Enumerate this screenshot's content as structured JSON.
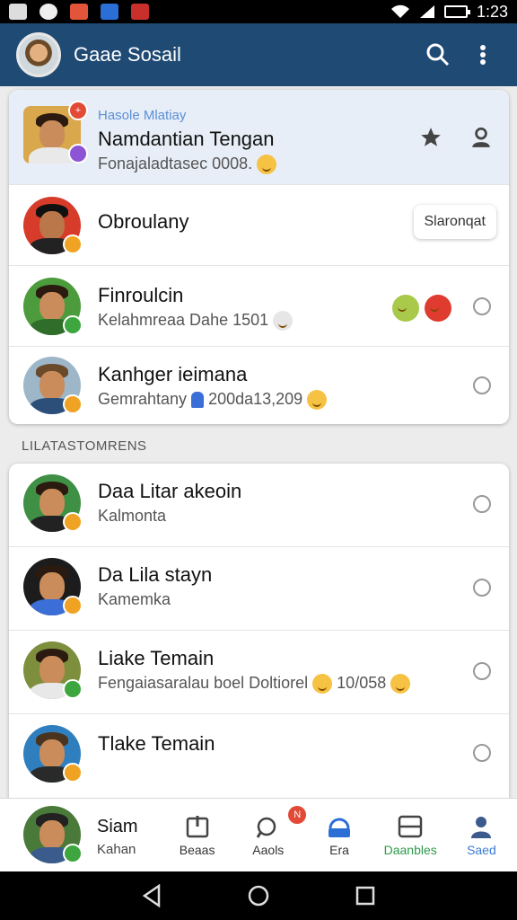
{
  "status_bar": {
    "time": "1:23"
  },
  "app_bar": {
    "title": "Gaae Sosail"
  },
  "top_card": {
    "label": "Hasole Mlatiay",
    "name": "Namdantian Tengan",
    "subtitle": "Fonajaladtasec 0008.",
    "badge_text": "+"
  },
  "group_one": [
    {
      "name": "Obroulany",
      "action_chip": "Slaronqat"
    },
    {
      "name": "Finroulcin",
      "subtitle": "Kelahmreaa Dahe 1501"
    },
    {
      "name": "Kanhger ieimana",
      "subtitle": "Gemrahtany",
      "subtitle_tail": "200da13,209"
    }
  ],
  "section_label": "LILATASTOMRENS",
  "group_two": [
    {
      "name": "Daa Litar akeoin",
      "subtitle": "Kalmonta"
    },
    {
      "name": "Da Lila stayn",
      "subtitle": "Kamemka"
    },
    {
      "name": "Liake Temain",
      "subtitle": "Fengaiasaralau boel Doltiorel",
      "subtitle_tail": "10/058"
    },
    {
      "name": "Tlake Temain",
      "subtitle": ""
    }
  ],
  "bottom_nav": {
    "profile_name": "Siam",
    "profile_sub": "Kahan",
    "items": [
      {
        "label": "Beaas",
        "color": "#333333"
      },
      {
        "label": "Aaols",
        "color": "#333333",
        "badge": "N"
      },
      {
        "label": "Era",
        "color": "#333333"
      },
      {
        "label": "Daanbles",
        "color": "#2e9a4a"
      },
      {
        "label": "Saed",
        "color": "#3b7bd6"
      }
    ]
  }
}
